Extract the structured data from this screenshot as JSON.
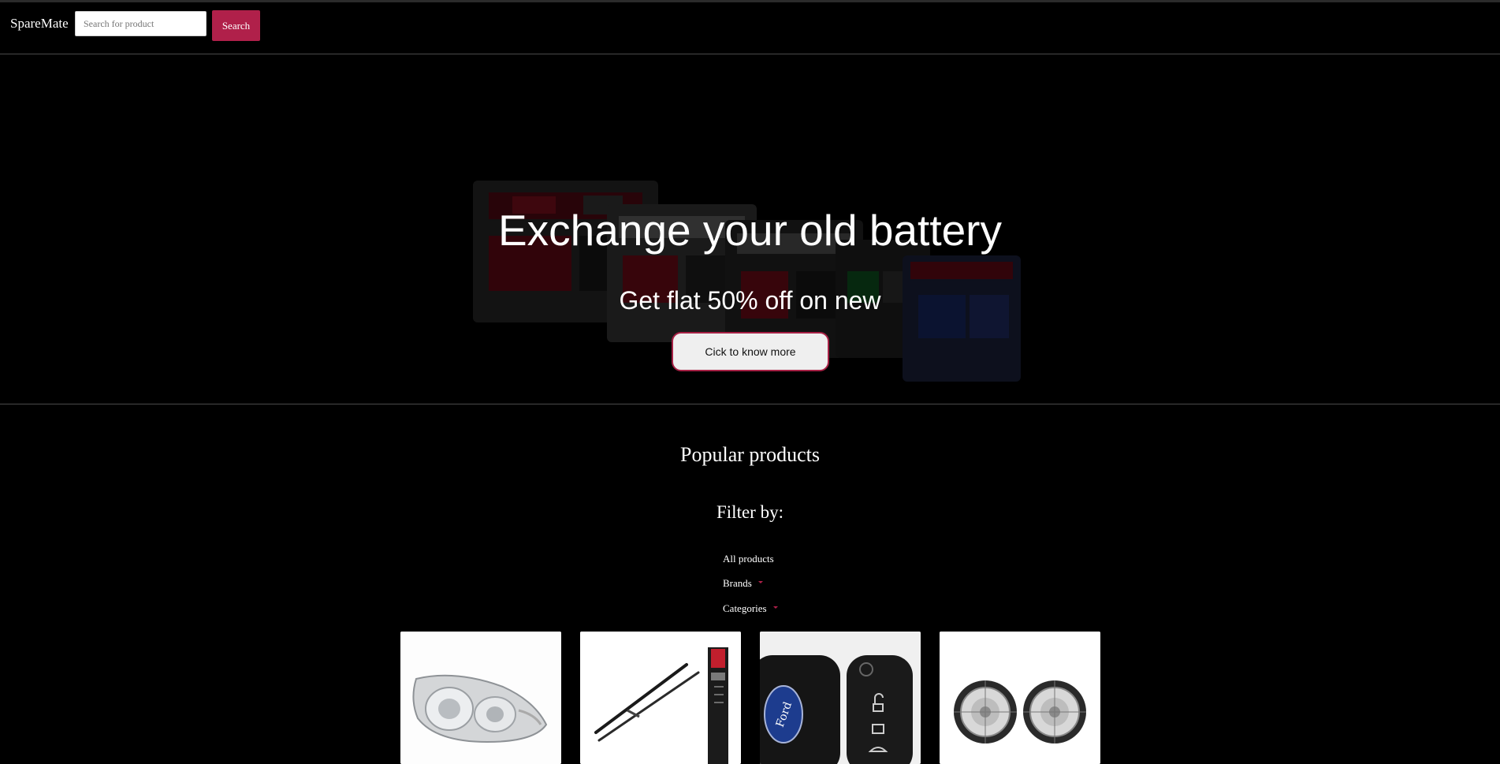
{
  "navbar": {
    "brand": "SpareMate",
    "search_placeholder": "Search for product",
    "search_button": "Search"
  },
  "hero": {
    "title": "Exchange your old battery",
    "subtitle": "Get flat 50% off on new",
    "cta": "Cick to know more"
  },
  "popular": {
    "title": "Popular products",
    "filter_label": "Filter by:",
    "filters": [
      {
        "label": "All products",
        "has_dropdown": false
      },
      {
        "label": "Brands",
        "has_dropdown": true
      },
      {
        "label": "Categories",
        "has_dropdown": true
      }
    ]
  },
  "products": [
    {
      "image": "headlight-image"
    },
    {
      "image": "wiper-blades-image"
    },
    {
      "image": "car-key-cover-image"
    },
    {
      "image": "fog-lamps-image"
    }
  ],
  "colors": {
    "accent": "#b0204a",
    "background": "#000000"
  }
}
